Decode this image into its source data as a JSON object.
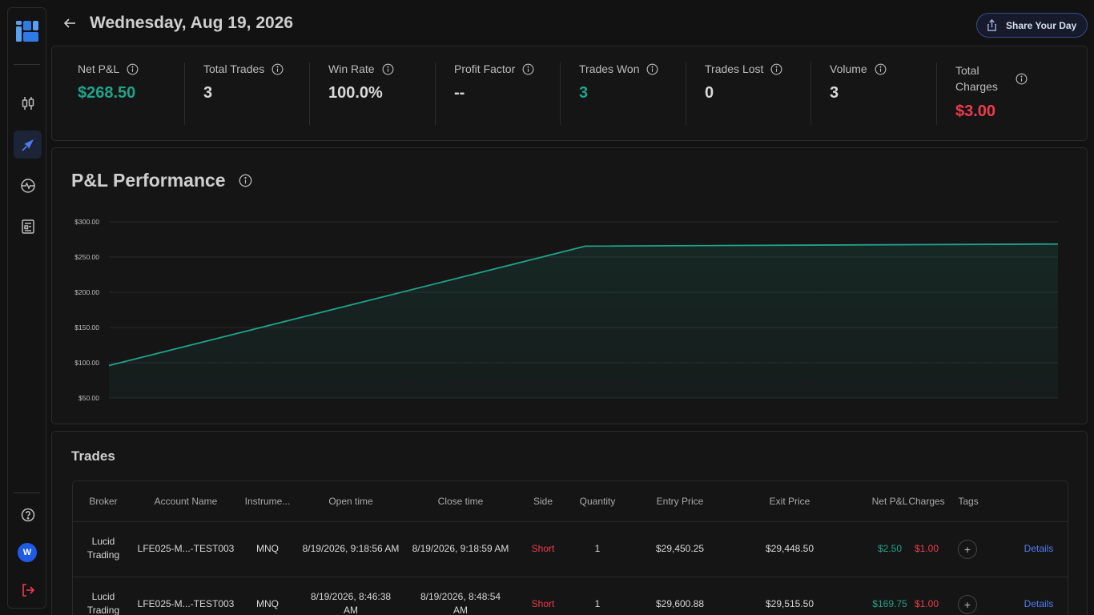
{
  "header": {
    "title": "Wednesday, Aug 19, 2026",
    "share_label": "Share Your Day"
  },
  "sidebar": {
    "items": [
      {
        "name": "candlestick-icon",
        "active": false
      },
      {
        "name": "compass-icon",
        "active": true
      },
      {
        "name": "activity-icon",
        "active": false
      },
      {
        "name": "reports-icon",
        "active": false
      }
    ],
    "avatar_letter": "W"
  },
  "stats": [
    {
      "label": "Net P&L",
      "value": "$268.50",
      "tone": "green"
    },
    {
      "label": "Total Trades",
      "value": "3",
      "tone": "neutral"
    },
    {
      "label": "Win Rate",
      "value": "100.0%",
      "tone": "neutral"
    },
    {
      "label": "Profit Factor",
      "value": "--",
      "tone": "neutral"
    },
    {
      "label": "Trades Won",
      "value": "3",
      "tone": "green"
    },
    {
      "label": "Trades Lost",
      "value": "0",
      "tone": "neutral"
    },
    {
      "label": "Volume",
      "value": "3",
      "tone": "neutral"
    },
    {
      "label_line1": "Total",
      "label_line2": "Charges",
      "value": "$3.00",
      "tone": "red"
    }
  ],
  "chart": {
    "title": "P&L Performance"
  },
  "chart_data": {
    "type": "area",
    "title": "P&L Performance",
    "x": [
      0,
      1,
      2
    ],
    "values": [
      96,
      265.5,
      268.5
    ],
    "ylim": [
      50,
      300
    ],
    "yticks": [
      "$300.00",
      "$250.00",
      "$200.00",
      "$150.00",
      "$100.00",
      "$50.00"
    ],
    "grid": true,
    "line_color": "#1fa38a"
  },
  "trades": {
    "title": "Trades",
    "columns": [
      "Broker",
      "Account Name",
      "Instrume...",
      "Open time",
      "Close time",
      "Side",
      "Quantity",
      "Entry Price",
      "Exit Price",
      "Net P&L",
      "Charges",
      "Tags"
    ],
    "rows": [
      {
        "broker": "Lucid Trading",
        "account": "LFE025-M...-TEST003",
        "instrument": "MNQ",
        "open": "8/19/2026, 9:18:56 AM",
        "close": "8/19/2026, 9:18:59 AM",
        "side": "Short",
        "qty": "1",
        "entry": "$29,450.25",
        "exit": "$29,448.50",
        "pnl": "$2.50",
        "charges": "$1.00",
        "details": "Details"
      },
      {
        "broker": "Lucid Trading",
        "account": "LFE025-M...-TEST003",
        "instrument": "MNQ",
        "open": "8/19/2026, 8:46:38 AM",
        "close": "8/19/2026, 8:48:54 AM",
        "side": "Short",
        "qty": "1",
        "entry": "$29,600.88",
        "exit": "$29,515.50",
        "pnl": "$169.75",
        "charges": "$1.00",
        "details": "Details"
      }
    ]
  }
}
